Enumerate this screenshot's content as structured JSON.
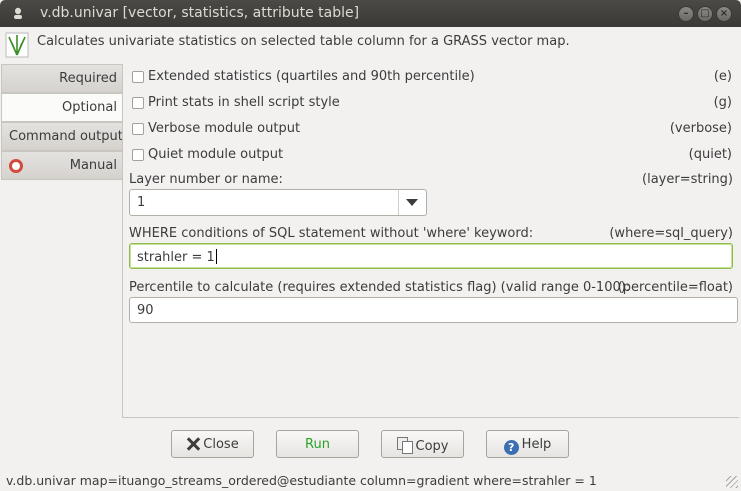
{
  "window": {
    "title": "v.db.univar [vector, statistics, attribute table]"
  },
  "description": "Calculates univariate statistics on selected table column for a GRASS vector map.",
  "tabs": [
    {
      "label": "Required"
    },
    {
      "label": "Optional"
    },
    {
      "label": "Command output"
    },
    {
      "label": "Manual"
    }
  ],
  "flags": [
    {
      "label": "Extended statistics (quartiles and 90th percentile)",
      "flag": "(e)",
      "checked": false
    },
    {
      "label": "Print stats in shell script style",
      "flag": "(g)",
      "checked": false
    },
    {
      "label": "Verbose module output",
      "flag": "(verbose)",
      "checked": false
    },
    {
      "label": "Quiet module output",
      "flag": "(quiet)",
      "checked": false
    }
  ],
  "layer": {
    "label": "Layer number or name:",
    "key": "(layer=string)",
    "value": "1"
  },
  "where": {
    "label": "WHERE conditions of SQL statement without 'where' keyword:",
    "key": "(where=sql_query)",
    "value": "strahler = 1"
  },
  "percentile": {
    "label": "Percentile to calculate (requires extended statistics flag) (valid range 0-100):",
    "key": "(percentile=float)",
    "value": "90"
  },
  "buttons": {
    "close": "Close",
    "run": "Run",
    "copy": "Copy",
    "help": "Help"
  },
  "statusbar": {
    "command": "v.db.univar map=ituango_streams_ordered@estudiante column=gradient where=strahler = 1"
  },
  "colors": {
    "run_text": "#29a32a",
    "focus_border": "#8fbd4b",
    "titlebar": "#3c3b37"
  },
  "icons": {
    "app": "app-icon",
    "grass": "grass-icon",
    "manual": "help-lifebuoy-icon",
    "close": "x-icon",
    "copy": "copy-icon",
    "help": "question-icon"
  }
}
